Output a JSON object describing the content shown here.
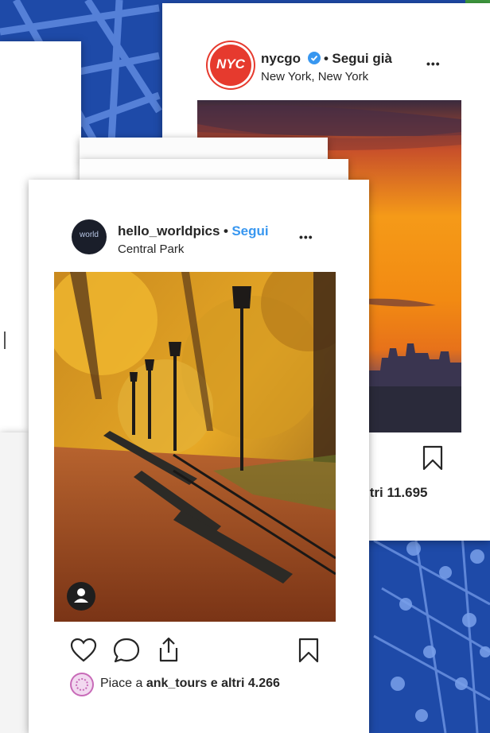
{
  "back_post": {
    "username": "nycgo",
    "avatar_text": "NYC",
    "follow_status": "Segui già",
    "location": "New York, New York",
    "more": "•••",
    "likes_text": "ltri 11.695"
  },
  "front_post": {
    "username": "hello_worldpics",
    "avatar_text": "world",
    "follow_label": "Segui",
    "location": "Central Park",
    "more": "•••",
    "likes_prefix": "Piace a ",
    "likes_user": "ank_tours",
    "likes_suffix": " e altri 4.266"
  },
  "colors": {
    "map_blue": "#1e4aa8",
    "follow_blue": "#3897f0",
    "verified_blue": "#3897f0",
    "text": "#262626"
  },
  "icons": [
    "heart-icon",
    "comment-icon",
    "share-icon",
    "bookmark-icon",
    "user-tag-icon",
    "verified-badge-icon"
  ]
}
